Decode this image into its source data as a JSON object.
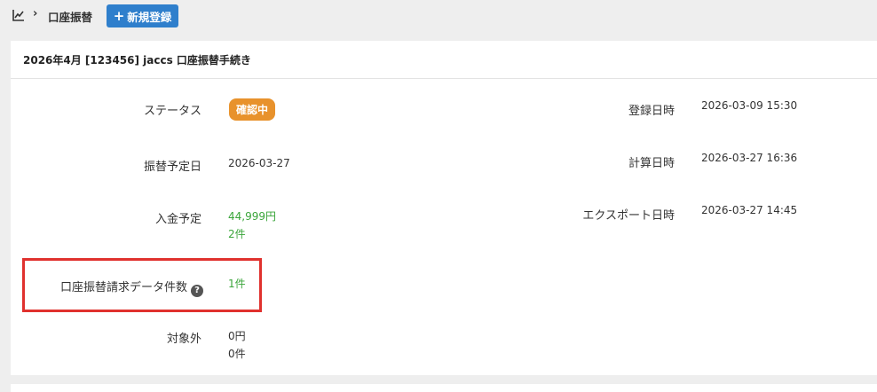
{
  "breadcrumb": {
    "title": "口座振替"
  },
  "toolbar": {
    "new_label": "新規登録"
  },
  "card": {
    "title": "2026年4月 [123456] jaccs 口座振替手続き"
  },
  "fields": {
    "status": {
      "label": "ステータス",
      "value": "確認中"
    },
    "transfer_date": {
      "label": "振替予定日",
      "value": "2026-03-27"
    },
    "deposit": {
      "label": "入金予定",
      "amount": "44,999円",
      "count": "2件"
    },
    "request_count": {
      "label": "口座振替請求データ件数",
      "value": "1件"
    },
    "excluded": {
      "label": "対象外",
      "amount": "0円",
      "count": "0件"
    },
    "registered_at": {
      "label": "登録日時",
      "value": "2026-03-09 15:30"
    },
    "calculated_at": {
      "label": "計算日時",
      "value": "2026-03-27 16:36"
    },
    "exported_at": {
      "label": "エクスポート日時",
      "value": "2026-03-27 14:45"
    }
  },
  "colors": {
    "badge": "#e8922c",
    "accent": "#2f7fcc",
    "green": "#3aa53a",
    "highlight": "#e0312e"
  },
  "icons": {
    "chart": "line-chart-icon",
    "help": "question-circle-icon"
  }
}
